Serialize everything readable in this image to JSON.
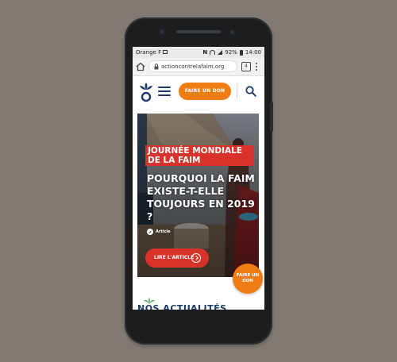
{
  "status_bar": {
    "carrier": "Orange F",
    "nfc": "N",
    "battery": "92%",
    "time": "14:00"
  },
  "browser": {
    "url": "actioncontrelafaim.org",
    "tabs_count": "4"
  },
  "header": {
    "donate_label": "FAIRE UN DON"
  },
  "hero": {
    "banner_title": "JOURNÉE MONDIALE DE LA FAIM",
    "headline": "POURQUOI LA FAIM EXISTE-T-ELLE TOUJOURS EN 2019 ?",
    "tag_label": "Article",
    "read_button": "LIRE L'ARTICLE"
  },
  "floating_donate": {
    "label": "FAIRE UN DON"
  },
  "news": {
    "heading": "NOS ACTUALITÉS"
  },
  "colors": {
    "brand_orange": "#ef7d14",
    "brand_red": "#d8332a",
    "brand_navy": "#1a3a6a",
    "leaf_green": "#2f9a3f"
  }
}
